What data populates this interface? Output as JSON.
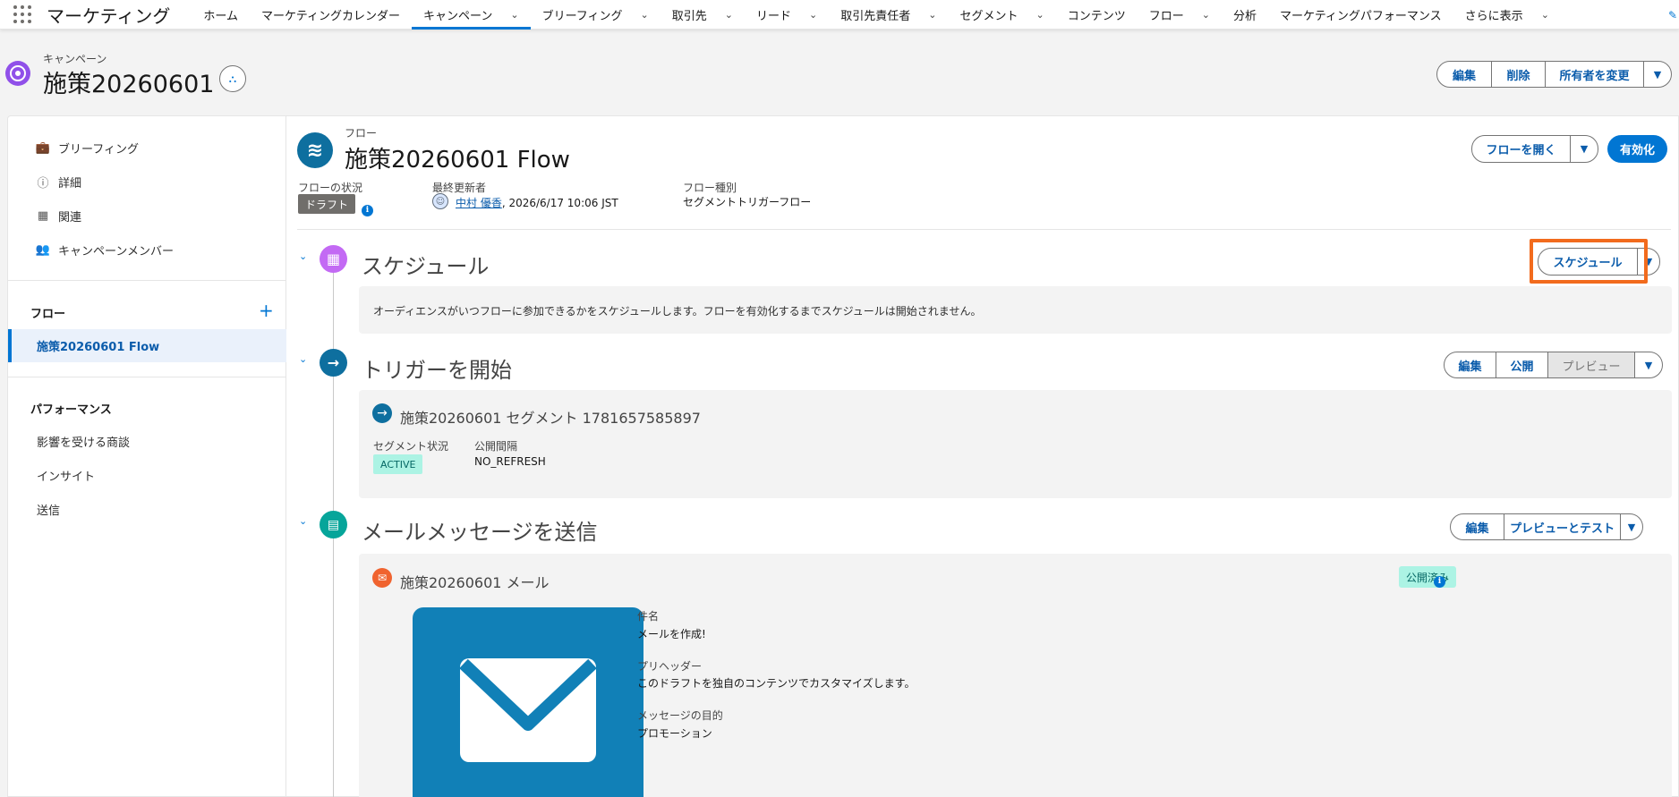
{
  "app": {
    "name": "マーケティング"
  },
  "nav": {
    "items": [
      {
        "label": "ホーム",
        "chev": false,
        "active": false
      },
      {
        "label": "マーケティングカレンダー",
        "chev": false,
        "active": false
      },
      {
        "label": "キャンペーン",
        "chev": true,
        "active": true
      },
      {
        "label": "ブリーフィング",
        "chev": true,
        "active": false
      },
      {
        "label": "取引先",
        "chev": true,
        "active": false
      },
      {
        "label": "リード",
        "chev": true,
        "active": false
      },
      {
        "label": "取引先責任者",
        "chev": true,
        "active": false
      },
      {
        "label": "セグメント",
        "chev": true,
        "active": false
      },
      {
        "label": "コンテンツ",
        "chev": false,
        "active": false
      },
      {
        "label": "フロー",
        "chev": true,
        "active": false
      },
      {
        "label": "分析",
        "chev": false,
        "active": false
      },
      {
        "label": "マーケティングパフォーマンス",
        "chev": false,
        "active": false
      },
      {
        "label": "さらに表示",
        "chev": true,
        "active": false
      }
    ]
  },
  "record": {
    "object_label": "キャンペーン",
    "title": "施策20260601",
    "actions": {
      "edit": "編集",
      "delete": "削除",
      "change_owner": "所有者を変更"
    }
  },
  "sidebar": {
    "items": [
      {
        "label": "ブリーフィング",
        "icon": "briefcase-icon"
      },
      {
        "label": "詳細",
        "icon": "info-icon"
      },
      {
        "label": "関連",
        "icon": "grid-icon"
      },
      {
        "label": "キャンペーンメンバー",
        "icon": "people-icon"
      }
    ],
    "flow_heading": "フロー",
    "flow_item": "施策20260601 Flow",
    "performance_heading": "パフォーマンス",
    "performance_links": [
      "影響を受ける商談",
      "インサイト",
      "送信"
    ]
  },
  "flow": {
    "label": "フロー",
    "title": "施策20260601 Flow",
    "status_label": "フローの状況",
    "status_value": "ドラフト",
    "updated_by_label": "最終更新者",
    "updated_by_user": "中村 優香",
    "updated_at": ", 2026/6/17 10:06 JST",
    "type_label": "フロー種別",
    "type_value": "セグメントトリガーフロー",
    "open_button": "フローを開く",
    "activate_button": "有効化"
  },
  "steps": {
    "schedule": {
      "title": "スケジュール",
      "button": "スケジュール",
      "description": "オーディエンスがいつフローに参加できるかをスケジュールします。フローを有効化するまでスケジュールは開始されません。"
    },
    "trigger": {
      "title": "トリガーを開始",
      "buttons": {
        "edit": "編集",
        "publish": "公開",
        "preview": "プレビュー"
      },
      "segment_name": "施策20260601 セグメント 1781657585897",
      "segment_status_label": "セグメント状況",
      "segment_status": "ACTIVE",
      "publish_interval_label": "公開間隔",
      "publish_interval": "NO_REFRESH"
    },
    "email": {
      "title": "メールメッセージを送信",
      "buttons": {
        "edit": "編集",
        "preview_test": "プレビューとテスト"
      },
      "email_name": "施策20260601 メール",
      "status": "公開済み",
      "subject_label": "件名",
      "subject": "メールを作成!",
      "preheader_label": "プリヘッダー",
      "preheader": "このドラフトを独自のコンテンツでカスタマイズします。",
      "purpose_label": "メッセージの目的",
      "purpose": "プロモーション"
    }
  },
  "colors": {
    "brand": "#0176d3",
    "highlight": "#f26b1d",
    "schedule_icon": "#c36af4",
    "trigger_icon": "#0e6f9f",
    "email_icon": "#06a59a",
    "email_preview": "#1180b7"
  }
}
